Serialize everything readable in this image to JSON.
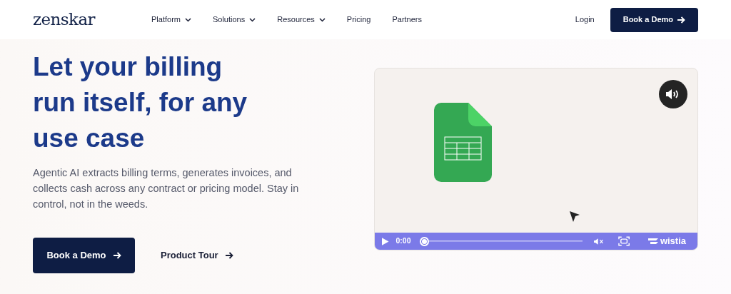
{
  "header": {
    "logo": "zenskar",
    "nav": [
      {
        "label": "Platform",
        "dropdown": true
      },
      {
        "label": "Solutions",
        "dropdown": true
      },
      {
        "label": "Resources",
        "dropdown": true
      },
      {
        "label": "Pricing",
        "dropdown": false
      },
      {
        "label": "Partners",
        "dropdown": false
      }
    ],
    "login": "Login",
    "cta": "Book a Demo"
  },
  "hero": {
    "headline": "Let your billing run itself, for any use case",
    "body": "Agentic AI extracts billing terms, generates invoices, and collects cash across any contract or pricing model. Stay in control, not in the weeds.",
    "primary_button": "Book a Demo",
    "secondary_link": "Product Tour"
  },
  "video": {
    "time": "0:00",
    "level": 0,
    "brand": "wistia"
  }
}
